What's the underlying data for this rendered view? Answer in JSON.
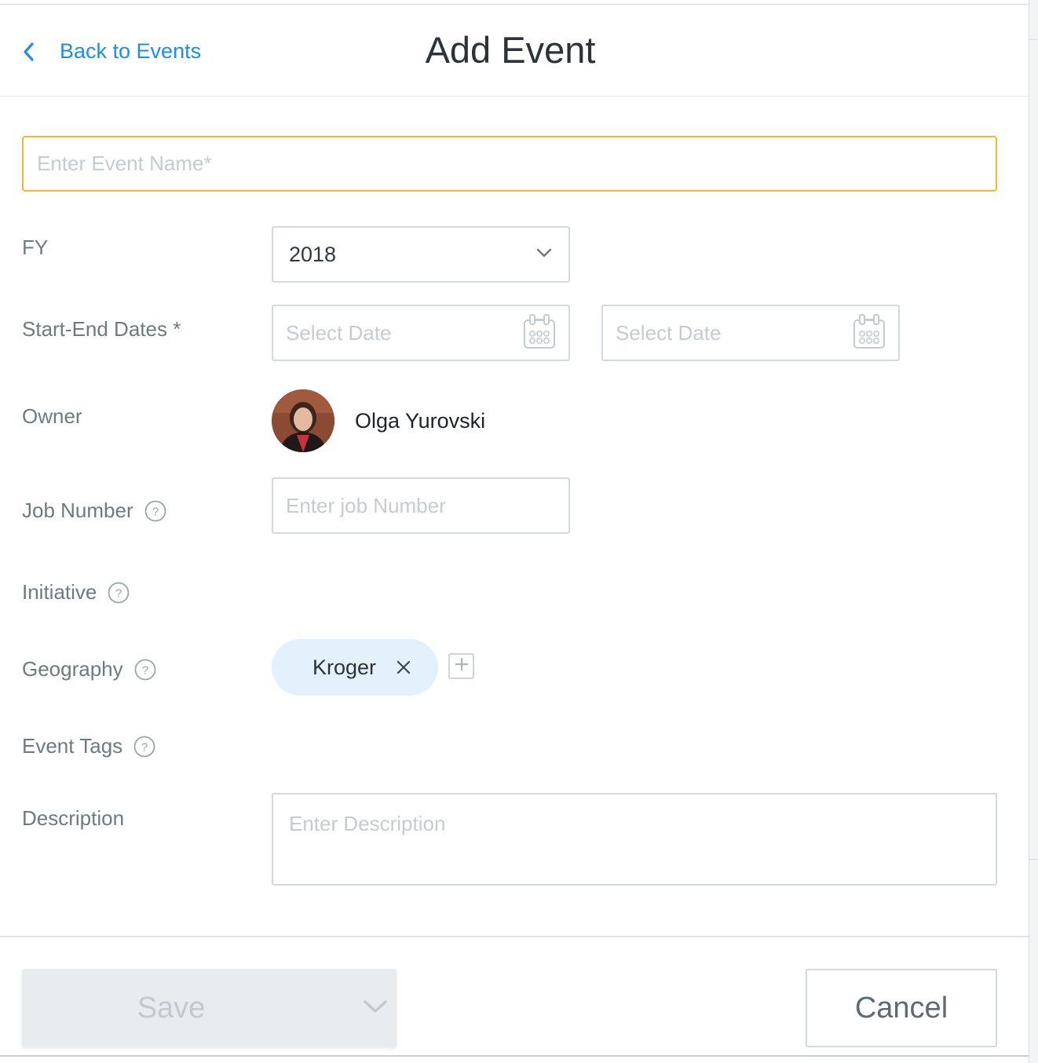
{
  "header": {
    "back_label": "Back to Events",
    "title": "Add Event"
  },
  "form": {
    "event_name": {
      "placeholder": "Enter Event Name*",
      "value": ""
    },
    "fy": {
      "label": "FY",
      "selected": "2018"
    },
    "dates": {
      "label": "Start-End Dates *",
      "start_placeholder": "Select Date",
      "end_placeholder": "Select Date"
    },
    "owner": {
      "label": "Owner",
      "name": "Olga Yurovski"
    },
    "job_number": {
      "label": "Job Number",
      "placeholder": "Enter job Number"
    },
    "initiative": {
      "label": "Initiative"
    },
    "geography": {
      "label": "Geography",
      "chips": [
        "Kroger"
      ]
    },
    "event_tags": {
      "label": "Event Tags"
    },
    "description": {
      "label": "Description",
      "placeholder": "Enter Description"
    }
  },
  "footer": {
    "save_label": "Save",
    "cancel_label": "Cancel"
  },
  "colors": {
    "accent_link": "#1f8ee0",
    "focus_border": "#f5b82e",
    "chip_bg": "#e3f1fc"
  },
  "icons": [
    "chevron-left-icon",
    "chevron-down-icon",
    "calendar-icon",
    "help-icon",
    "close-icon",
    "plus-icon"
  ]
}
